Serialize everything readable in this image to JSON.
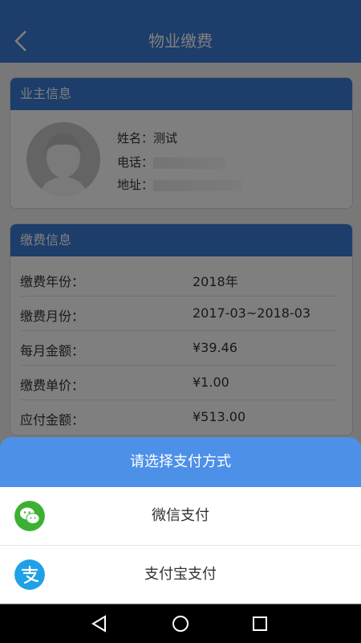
{
  "header": {
    "title": "物业缴费"
  },
  "owner": {
    "section_title": "业主信息",
    "name_label": "姓名：",
    "name_value": "测试",
    "phone_label": "电话：",
    "address_label": "地址："
  },
  "fee": {
    "section_title": "缴费信息",
    "rows": [
      {
        "label": "缴费年份：",
        "value": "2018年"
      },
      {
        "label": "缴费月份：",
        "value": "2017-03~2018-03"
      },
      {
        "label": "每月金额：",
        "value": "¥39.46"
      },
      {
        "label": "缴费单价：",
        "value": "¥1.00"
      },
      {
        "label": "应付金额：",
        "value": "¥513.00"
      }
    ]
  },
  "payment_sheet": {
    "title": "请选择支付方式",
    "options": [
      {
        "label": "微信支付",
        "icon": "wechat-icon",
        "color": "#3cb034"
      },
      {
        "label": "支付宝支付",
        "icon": "alipay-icon",
        "color": "#1ea1e6"
      }
    ]
  },
  "colors": {
    "primary": "#3a7bd5",
    "sheet_header": "#4d90e8"
  }
}
